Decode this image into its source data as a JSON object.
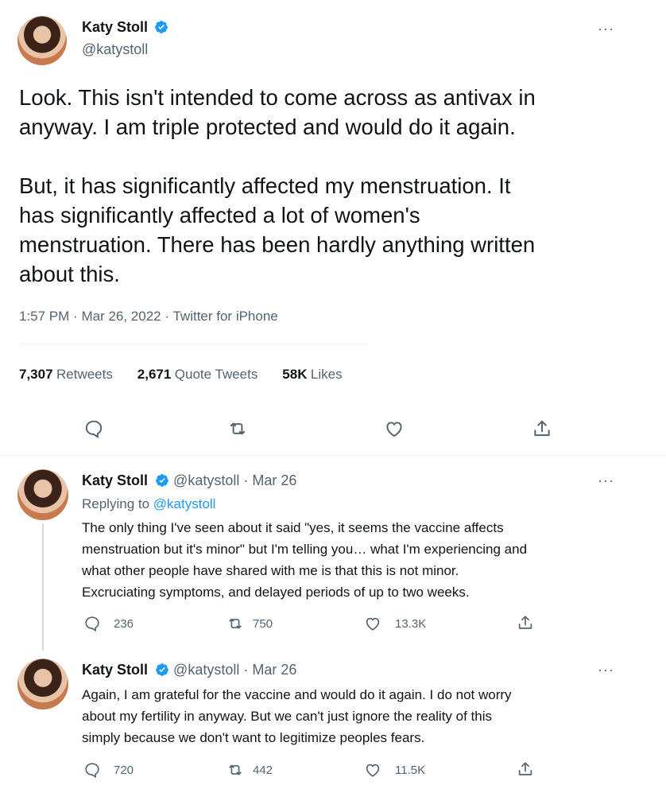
{
  "main_tweet": {
    "author_name": "Katy Stoll",
    "author_handle": "@katystoll",
    "more_label": "···",
    "text": "Look. This isn't intended to come across as antivax in\nanyway. I am triple protected and would do it again.\n\nBut, it has significantly affected my menstruation. It\nhas significantly affected a lot of women's\nmenstruation. There has been hardly anything written\nabout this.",
    "time": "1:57 PM",
    "date": "Mar 26, 2022",
    "source": "Twitter for iPhone",
    "separator": "·",
    "stats": {
      "retweets_count": "7,307",
      "retweets_label": "Retweets",
      "quotes_count": "2,671",
      "quotes_label": "Quote Tweets",
      "likes_count": "58K",
      "likes_label": "Likes"
    }
  },
  "replies": [
    {
      "author_name": "Katy Stoll",
      "author_handle": "@katystoll",
      "date": "Mar 26",
      "separator": "·",
      "more_label": "···",
      "replying_prefix": "Replying to ",
      "replying_to": "@katystoll",
      "text": "The only thing I've seen about it said \"yes, it seems the vaccine affects\nmenstruation but it's minor\" but I'm telling you… what I'm experiencing and\nwhat other people have shared with me is that this is not minor.\nExcruciating symptoms, and delayed periods of up to two weeks.",
      "reply_count": "236",
      "retweet_count": "750",
      "like_count": "13.3K"
    },
    {
      "author_name": "Katy Stoll",
      "author_handle": "@katystoll",
      "date": "Mar 26",
      "separator": "·",
      "more_label": "···",
      "text": "Again, I am grateful for the vaccine and would do it again. I do not worry\nabout my fertility in anyway. But we can't just ignore the reality of this\nsimply because we don't want to legitimize peoples fears.",
      "reply_count": "720",
      "retweet_count": "442",
      "like_count": "11.5K"
    }
  ],
  "icons": {
    "verified": "verified-badge-icon",
    "reply": "reply-icon",
    "retweet": "retweet-icon",
    "like": "heart-icon",
    "share": "share-icon"
  },
  "colors": {
    "accent": "#1d9bf0",
    "text": "#0f1419",
    "secondary": "#536471"
  }
}
